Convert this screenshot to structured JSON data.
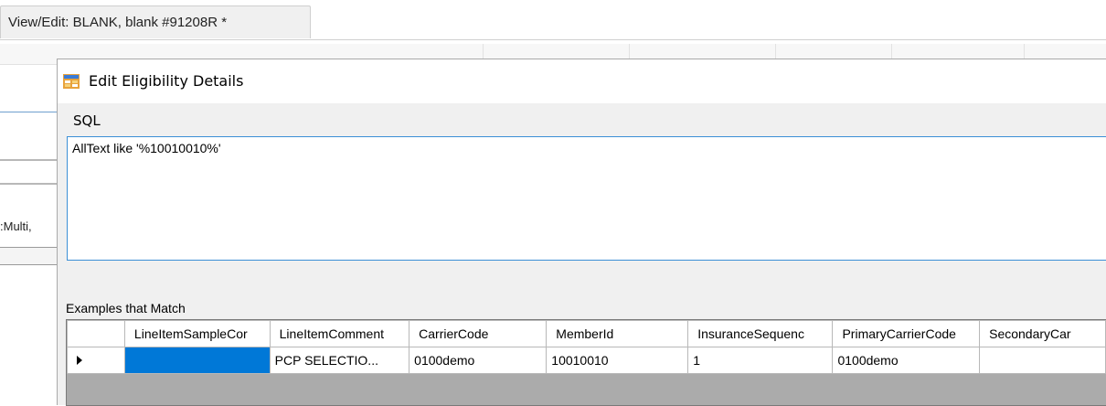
{
  "background_app": {
    "tab_title": "View/Edit: BLANK, blank #91208R *",
    "left_fragment": ":Multi,"
  },
  "dialog": {
    "title": "Edit Eligibility Details",
    "icon": "window-app-icon",
    "sql_label": "SQL",
    "sql_text": "AllText like '%10010010%'",
    "examples_label": "Examples that Match",
    "grid": {
      "columns": [
        "LineItemSampleCor",
        "LineItemComment",
        "CarrierCode",
        "MemberId",
        "InsuranceSequenc",
        "PrimaryCarrierCode",
        "SecondaryCar"
      ],
      "rows": [
        {
          "LineItemSampleCor": "",
          "LineItemComment": "PCP SELECTIO...",
          "CarrierCode": "0100demo",
          "MemberId": "10010010",
          "InsuranceSequenc": "1",
          "PrimaryCarrierCode": "0100demo",
          "SecondaryCar": ""
        }
      ]
    }
  },
  "colors": {
    "accent": "#0078d7",
    "focus_border": "#3c8fd6",
    "grid_empty": "#ababab"
  }
}
